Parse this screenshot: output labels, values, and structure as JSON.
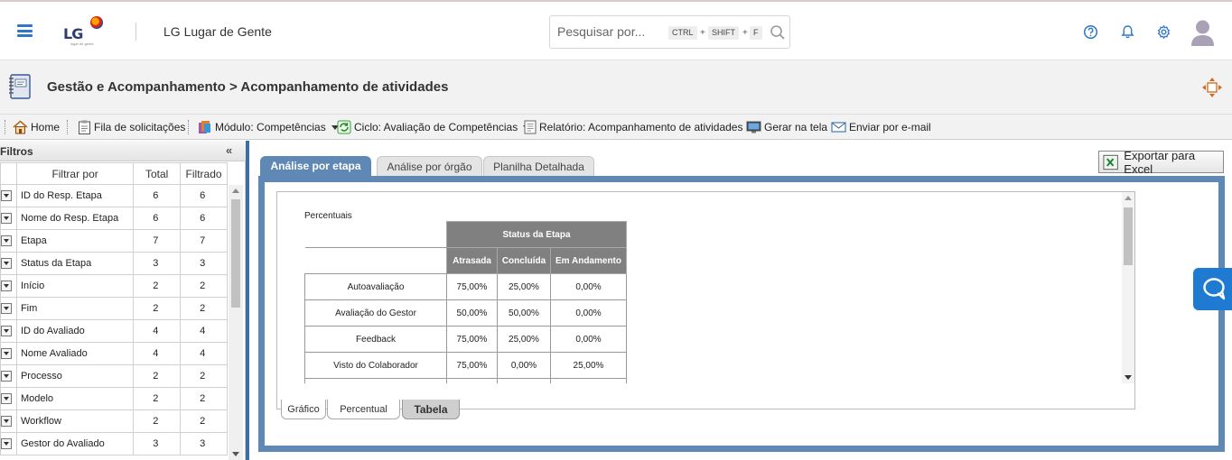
{
  "header": {
    "logo_text": "LG",
    "logo_tagline": "lugar de gente",
    "app_title": "LG Lugar de Gente",
    "search": {
      "placeholder": "Pesquisar por...",
      "keys": [
        "CTRL",
        "SHIFT",
        "F"
      ],
      "plus": "+"
    },
    "icons": [
      "help-icon",
      "bell-icon",
      "gear-icon",
      "avatar"
    ]
  },
  "page": {
    "title": "Gestão e Acompanhamento > Acompanhamento de atividades"
  },
  "toolbar": {
    "items": [
      {
        "label": "Home",
        "icon": "home-icon"
      },
      {
        "label": "Fila de solicitações",
        "icon": "clipboard-icon"
      },
      {
        "label": "Módulo: Competências",
        "icon": "module-icon"
      },
      {
        "label": "Ciclo: Avaliação de Competências",
        "icon": "cycle-icon"
      },
      {
        "label": "Relatório: Acompanhamento de atividades",
        "icon": "report-icon"
      },
      {
        "label": "Gerar na tela",
        "icon": "screen-icon"
      },
      {
        "label": "Enviar por e-mail",
        "icon": "mail-icon"
      }
    ]
  },
  "filters": {
    "title": "Filtros",
    "collapse": "«",
    "columns": [
      "Filtrar por",
      "Total",
      "Filtrado"
    ],
    "rows": [
      {
        "name": "ID do Resp. Etapa",
        "total": "6",
        "filtered": "6"
      },
      {
        "name": "Nome do Resp. Etapa",
        "total": "6",
        "filtered": "6"
      },
      {
        "name": "Etapa",
        "total": "7",
        "filtered": "7"
      },
      {
        "name": "Status da Etapa",
        "total": "3",
        "filtered": "3"
      },
      {
        "name": "Início",
        "total": "2",
        "filtered": "2"
      },
      {
        "name": "Fim",
        "total": "2",
        "filtered": "2"
      },
      {
        "name": "ID do Avaliado",
        "total": "4",
        "filtered": "4"
      },
      {
        "name": "Nome Avaliado",
        "total": "4",
        "filtered": "4"
      },
      {
        "name": "Processo",
        "total": "2",
        "filtered": "2"
      },
      {
        "name": "Modelo",
        "total": "2",
        "filtered": "2"
      },
      {
        "name": "Workflow",
        "total": "2",
        "filtered": "2"
      },
      {
        "name": "Gestor do Avaliado",
        "total": "3",
        "filtered": "3"
      }
    ]
  },
  "main": {
    "tabs": [
      {
        "label": "Análise por etapa",
        "active": true
      },
      {
        "label": "Análise por órgão",
        "active": false
      },
      {
        "label": "Planilha Detalhada",
        "active": false
      }
    ],
    "export_label": "Exportar para Excel",
    "percent_label": "Percentuais",
    "table": {
      "group_header": "Status da Etapa",
      "columns": [
        "Atrasada",
        "Concluída",
        "Em Andamento"
      ],
      "rows": [
        {
          "name": "Autoavaliação",
          "values": [
            "75,00%",
            "25,00%",
            "0,00%"
          ]
        },
        {
          "name": "Avaliação do Gestor",
          "values": [
            "50,00%",
            "50,00%",
            "0,00%"
          ]
        },
        {
          "name": "Feedback",
          "values": [
            "75,00%",
            "25,00%",
            "0,00%"
          ]
        },
        {
          "name": "Visto do Colaborador",
          "values": [
            "75,00%",
            "0,00%",
            "25,00%"
          ]
        }
      ]
    },
    "bottom_tabs": [
      {
        "label": "Gráfico",
        "active": false
      },
      {
        "label": "Percentual",
        "active": false
      },
      {
        "label": "Tabela",
        "active": true
      }
    ]
  },
  "colors": {
    "accent": "#2f76c6",
    "tab_active": "#5f88b4",
    "table_header": "#808080",
    "chat": "#1f7ad1"
  }
}
